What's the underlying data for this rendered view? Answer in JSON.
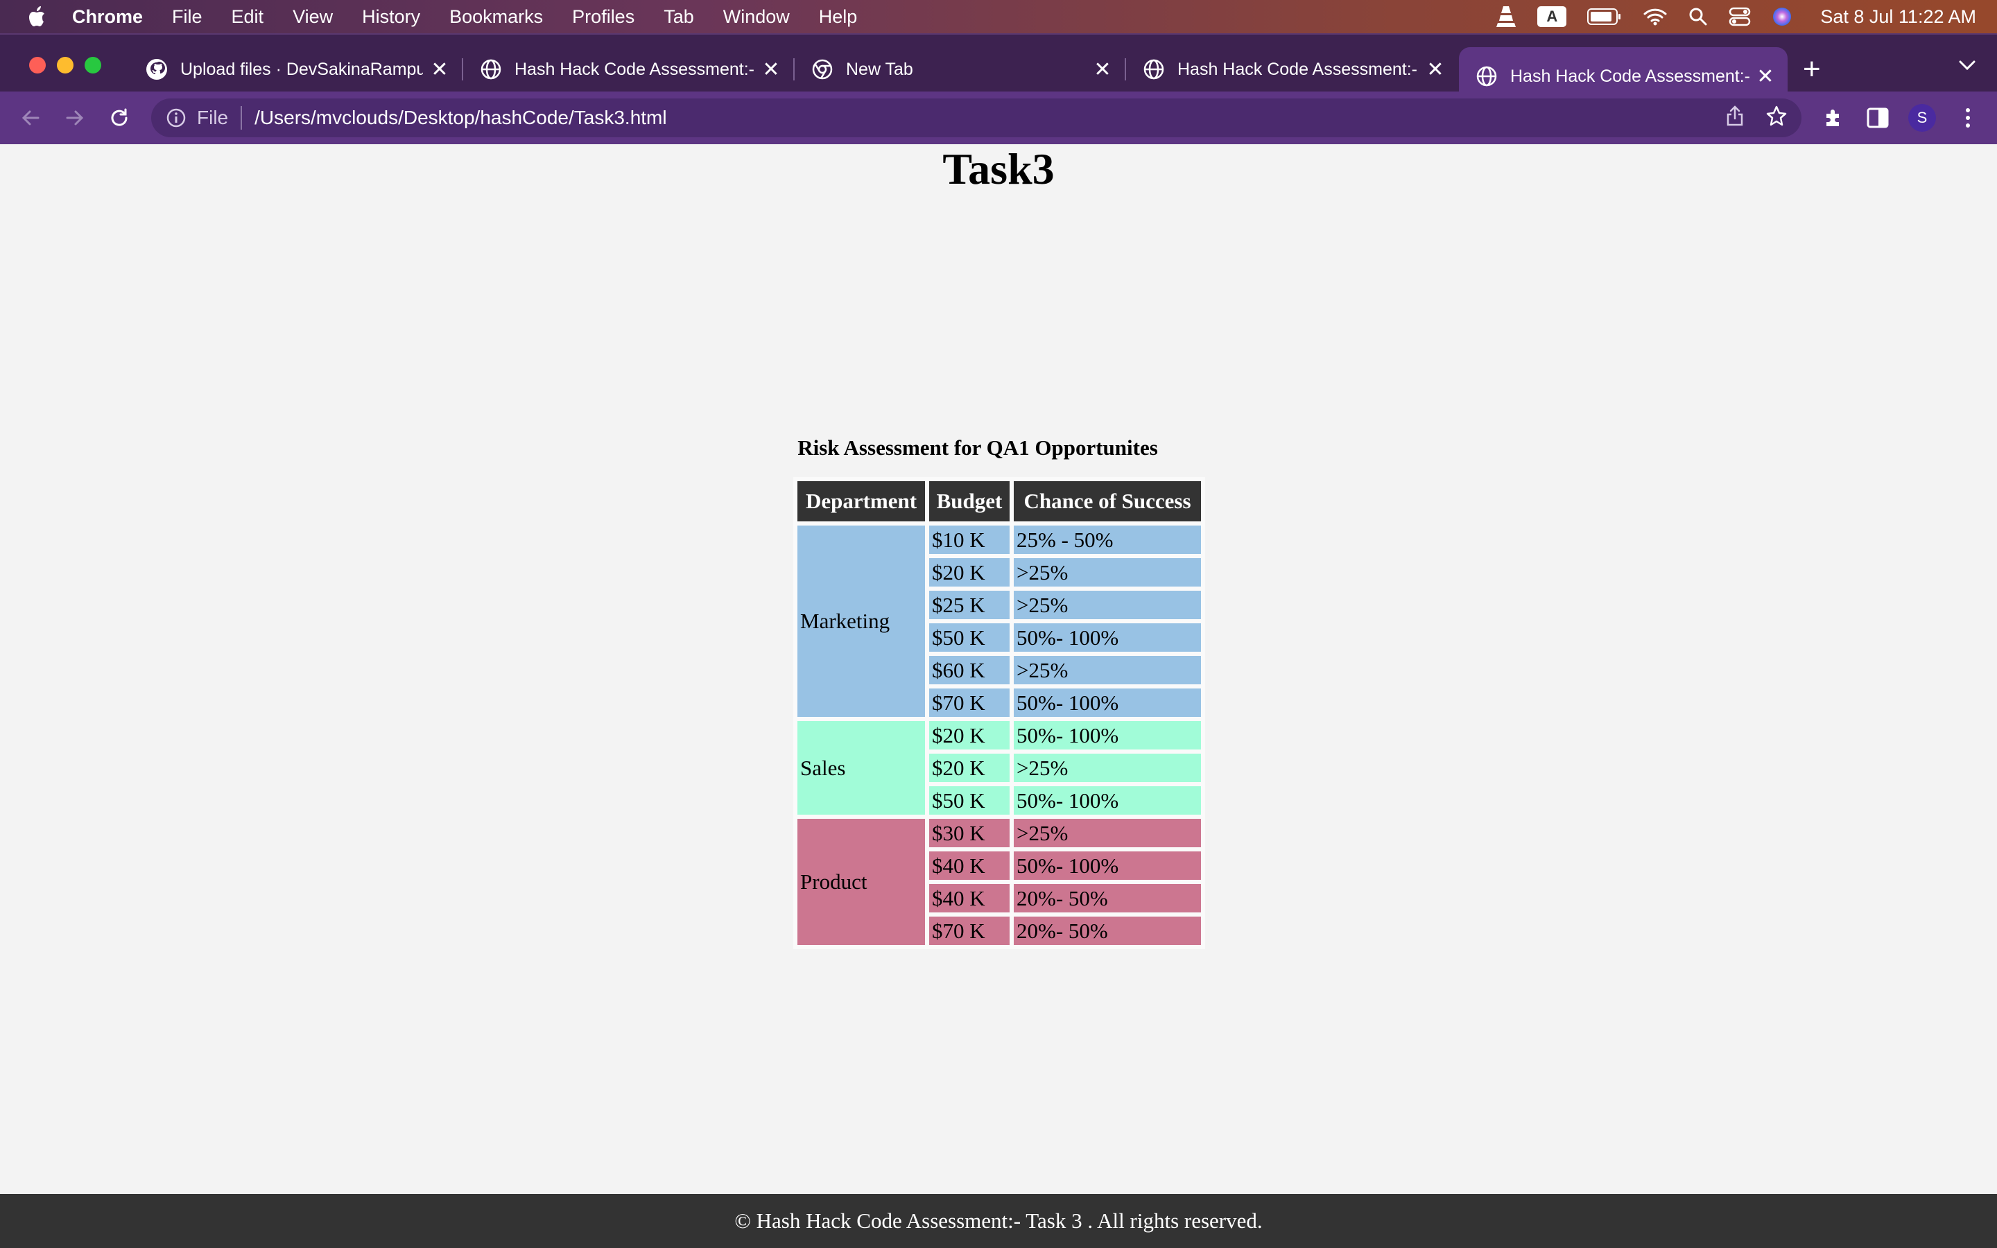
{
  "menubar": {
    "app_name": "Chrome",
    "items": [
      "File",
      "Edit",
      "View",
      "History",
      "Bookmarks",
      "Profiles",
      "Tab",
      "Window",
      "Help"
    ],
    "input_source": "A",
    "clock": "Sat 8 Jul  11:22 AM"
  },
  "tabs": [
    {
      "title": "Upload files · DevSakinaRampu",
      "icon": "github-icon"
    },
    {
      "title": "Hash Hack Code Assessment:-",
      "icon": "globe-icon"
    },
    {
      "title": "New Tab",
      "icon": "chrome-icon"
    },
    {
      "title": "Hash Hack Code Assessment:-",
      "icon": "globe-icon"
    },
    {
      "title": "Hash Hack Code Assessment:-",
      "icon": "globe-icon",
      "active": true
    }
  ],
  "toolbar": {
    "scheme": "File",
    "url": "/Users/mvclouds/Desktop/hashCode/Task3.html",
    "profile_initial": "S"
  },
  "page": {
    "title": "Task3",
    "table": {
      "caption": "Risk Assessment for QA1 Opportunites",
      "headers": [
        "Department",
        "Budget",
        "Chance of Success"
      ],
      "groups": [
        {
          "department": "Marketing",
          "color": "#98c2e4",
          "rows": [
            {
              "budget": "$10 K",
              "chance": "25% - 50%"
            },
            {
              "budget": "$20 K",
              "chance": ">25%"
            },
            {
              "budget": "$25 K",
              "chance": ">25%"
            },
            {
              "budget": "$50 K",
              "chance": "50%- 100%"
            },
            {
              "budget": "$60 K",
              "chance": ">25%"
            },
            {
              "budget": "$70 K",
              "chance": "50%- 100%"
            }
          ]
        },
        {
          "department": "Sales",
          "color": "#a1fcd8",
          "rows": [
            {
              "budget": "$20 K",
              "chance": "50%- 100%"
            },
            {
              "budget": "$20 K",
              "chance": ">25%"
            },
            {
              "budget": "$50 K",
              "chance": "50%- 100%"
            }
          ]
        },
        {
          "department": "Product",
          "color": "#cc7690",
          "rows": [
            {
              "budget": "$30 K",
              "chance": ">25%"
            },
            {
              "budget": "$40 K",
              "chance": "50%- 100%"
            },
            {
              "budget": "$40 K",
              "chance": "20%- 50%"
            },
            {
              "budget": "$70 K",
              "chance": "20%- 50%"
            }
          ]
        }
      ]
    },
    "footer": "© Hash Hack Code Assessment:- Task 3 . All rights reserved."
  }
}
